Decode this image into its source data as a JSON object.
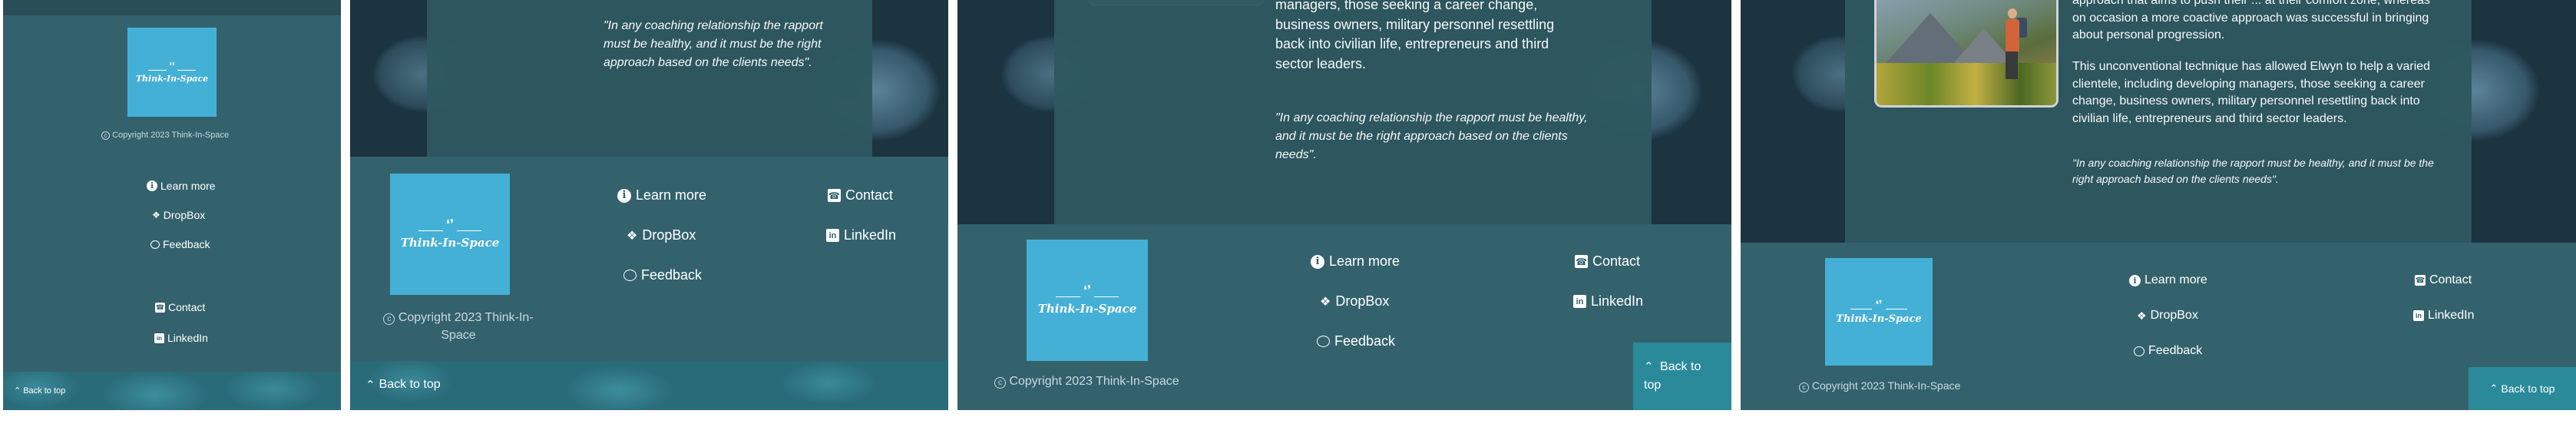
{
  "brand": {
    "logo_text": "Think-In-Space",
    "copyright": "Copyright 2023 Think-In-Space",
    "colors": {
      "logo_bg": "#45b0d6",
      "footer_bg": "#33626d",
      "content_bg": "#2e5860",
      "back_to_top_bg": "#2a8a9a"
    }
  },
  "footer_links": {
    "learn_more": "Learn more",
    "dropbox": "DropBox",
    "feedback": "Feedback",
    "contact": "Contact",
    "linkedin": "LinkedIn"
  },
  "back_to_top": "Back to top",
  "content": {
    "quote": "\"In any coaching relationship the rapport must be healthy, and it must be the right approach based on the clients needs\".",
    "para_p3": "managers, those seeking a career change, business owners, military personnel resettling back into civilian life, entrepreneurs and third sector leaders.",
    "para_p4_top": "approach that aims to push their ... at their comfort zone, whereas on occasion a more coactive approach was successful in bringing about personal progression.",
    "para_p4_main": "This unconventional technique has allowed Elwyn to help a varied clientele, including developing managers, those seeking a career change, business owners, military personnel resettling back into civilian life, entrepreneurs and third sector leaders."
  },
  "icons": {
    "learn_more": "info-circle-icon",
    "dropbox": "dropbox-icon",
    "feedback": "chat-bubble-icon",
    "contact": "phone-square-icon",
    "linkedin": "linkedin-icon",
    "copyright": "copyright-icon",
    "back_to_top": "chevron-up-icon"
  }
}
